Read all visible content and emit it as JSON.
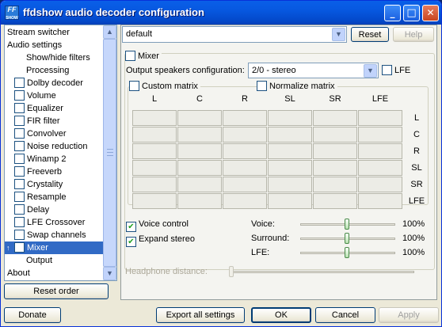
{
  "window": {
    "title": "ffdshow audio decoder configuration",
    "icon_text": "FF",
    "icon_sub": "SHOW",
    "minimize": "_",
    "maximize": "□",
    "close": "✕"
  },
  "tree": {
    "items": [
      {
        "label": "Stream switcher",
        "checkbox": false,
        "checked": false,
        "selected": false
      },
      {
        "label": "Audio settings",
        "checkbox": false,
        "checked": false,
        "selected": false
      },
      {
        "label": "Show/hide filters",
        "checkbox": false,
        "checked": false,
        "selected": false
      },
      {
        "label": "Processing",
        "checkbox": false,
        "checked": false,
        "selected": false
      },
      {
        "label": "Dolby decoder",
        "checkbox": true,
        "checked": false,
        "selected": false
      },
      {
        "label": "Volume",
        "checkbox": true,
        "checked": false,
        "selected": false
      },
      {
        "label": "Equalizer",
        "checkbox": true,
        "checked": false,
        "selected": false
      },
      {
        "label": "FIR filter",
        "checkbox": true,
        "checked": false,
        "selected": false
      },
      {
        "label": "Convolver",
        "checkbox": true,
        "checked": false,
        "selected": false
      },
      {
        "label": "Noise reduction",
        "checkbox": true,
        "checked": false,
        "selected": false
      },
      {
        "label": "Winamp 2",
        "checkbox": true,
        "checked": false,
        "selected": false
      },
      {
        "label": "Freeverb",
        "checkbox": true,
        "checked": false,
        "selected": false
      },
      {
        "label": "Crystality",
        "checkbox": true,
        "checked": false,
        "selected": false
      },
      {
        "label": "Resample",
        "checkbox": true,
        "checked": false,
        "selected": false
      },
      {
        "label": "Delay",
        "checkbox": true,
        "checked": false,
        "selected": false
      },
      {
        "label": "LFE Crossover",
        "checkbox": true,
        "checked": false,
        "selected": false
      },
      {
        "label": "Swap channels",
        "checkbox": true,
        "checked": false,
        "selected": false
      },
      {
        "label": "Mixer",
        "checkbox": true,
        "checked": false,
        "selected": true
      },
      {
        "label": "Output",
        "checkbox": false,
        "checked": false,
        "selected": false
      },
      {
        "label": "About",
        "checkbox": false,
        "checked": false,
        "selected": false
      }
    ],
    "up_arrow": "▲",
    "down_arrow": "▼",
    "move_marker": "↑"
  },
  "reset_order": "Reset order",
  "preset": {
    "value": "default",
    "arrow": "▼",
    "reset": "Reset",
    "help": "Help"
  },
  "mixer": {
    "enable_label": "Mixer",
    "enabled": false,
    "speakers_label": "Output speakers configuration:",
    "speakers_value": "2/0 - stereo",
    "lfe_label": "LFE",
    "lfe": false,
    "custom_matrix": "Custom matrix",
    "custom_matrix_checked": false,
    "normalize_matrix": "Normalize matrix",
    "normalize_checked": false,
    "columns": [
      "L",
      "C",
      "R",
      "SL",
      "SR",
      "LFE"
    ],
    "rows": [
      "L",
      "C",
      "R",
      "SL",
      "SR",
      "LFE"
    ],
    "voice_control": "Voice control",
    "voice_control_checked": true,
    "expand_stereo": "Expand stereo",
    "expand_stereo_checked": true,
    "sliders": [
      {
        "label": "Voice:",
        "value": "100%",
        "level": 0.5
      },
      {
        "label": "Surround:",
        "value": "100%",
        "level": 0.5
      },
      {
        "label": "LFE:",
        "value": "100%",
        "level": 0.5
      }
    ],
    "headphone_label": "Headphone distance:"
  },
  "buttons": {
    "donate": "Donate",
    "export": "Export all settings",
    "ok": "OK",
    "cancel": "Cancel",
    "apply": "Apply"
  }
}
